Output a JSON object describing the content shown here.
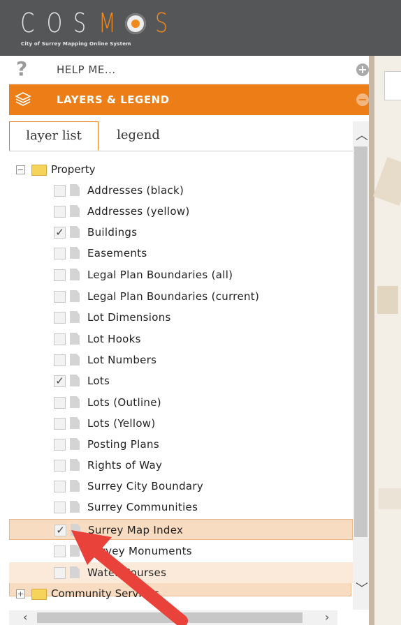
{
  "header": {
    "logo_letters": [
      "C",
      "O",
      "S",
      "M",
      "S"
    ],
    "logo_subtitle": "City of Surrey Mapping Online System"
  },
  "sidebar": {
    "help_label": "HELP ME...",
    "layers_label": "LAYERS & LEGEND"
  },
  "tabs": [
    {
      "label": "layer list",
      "active": true
    },
    {
      "label": "legend",
      "active": false
    }
  ],
  "tree": {
    "property": {
      "label": "Property",
      "expanded": true,
      "layers": [
        {
          "label": "Addresses (black)",
          "checked": false
        },
        {
          "label": "Addresses (yellow)",
          "checked": false
        },
        {
          "label": "Buildings",
          "checked": true
        },
        {
          "label": "Easements",
          "checked": false
        },
        {
          "label": "Legal Plan Boundaries (all)",
          "checked": false
        },
        {
          "label": "Legal Plan Boundaries (current)",
          "checked": false
        },
        {
          "label": "Lot Dimensions",
          "checked": false
        },
        {
          "label": "Lot Hooks",
          "checked": false
        },
        {
          "label": "Lot Numbers",
          "checked": false
        },
        {
          "label": "Lots",
          "checked": true
        },
        {
          "label": "Lots (Outline)",
          "checked": false
        },
        {
          "label": "Lots (Yellow)",
          "checked": false
        },
        {
          "label": "Posting Plans",
          "checked": false
        },
        {
          "label": "Rights of Way",
          "checked": false
        },
        {
          "label": "Surrey City Boundary",
          "checked": false
        },
        {
          "label": "Surrey Communities",
          "checked": false
        },
        {
          "label": "Surrey Map Index",
          "checked": true
        },
        {
          "label": "Survey Monuments",
          "checked": false
        },
        {
          "label": "Water Courses",
          "checked": false
        }
      ]
    },
    "community_services": {
      "label": "Community Services",
      "expanded": false
    }
  },
  "icons": {
    "help": "question-icon",
    "layers": "layers-icon",
    "expand": "plus-circle-icon",
    "collapse": "minus-circle-icon",
    "folder": "folder-icon",
    "layer": "document-icon",
    "check": "check-icon"
  },
  "colors": {
    "header_bg": "#555658",
    "accent": "#ec7d17",
    "selected_row": "#f8dcc2",
    "arrow": "#e8423a"
  }
}
